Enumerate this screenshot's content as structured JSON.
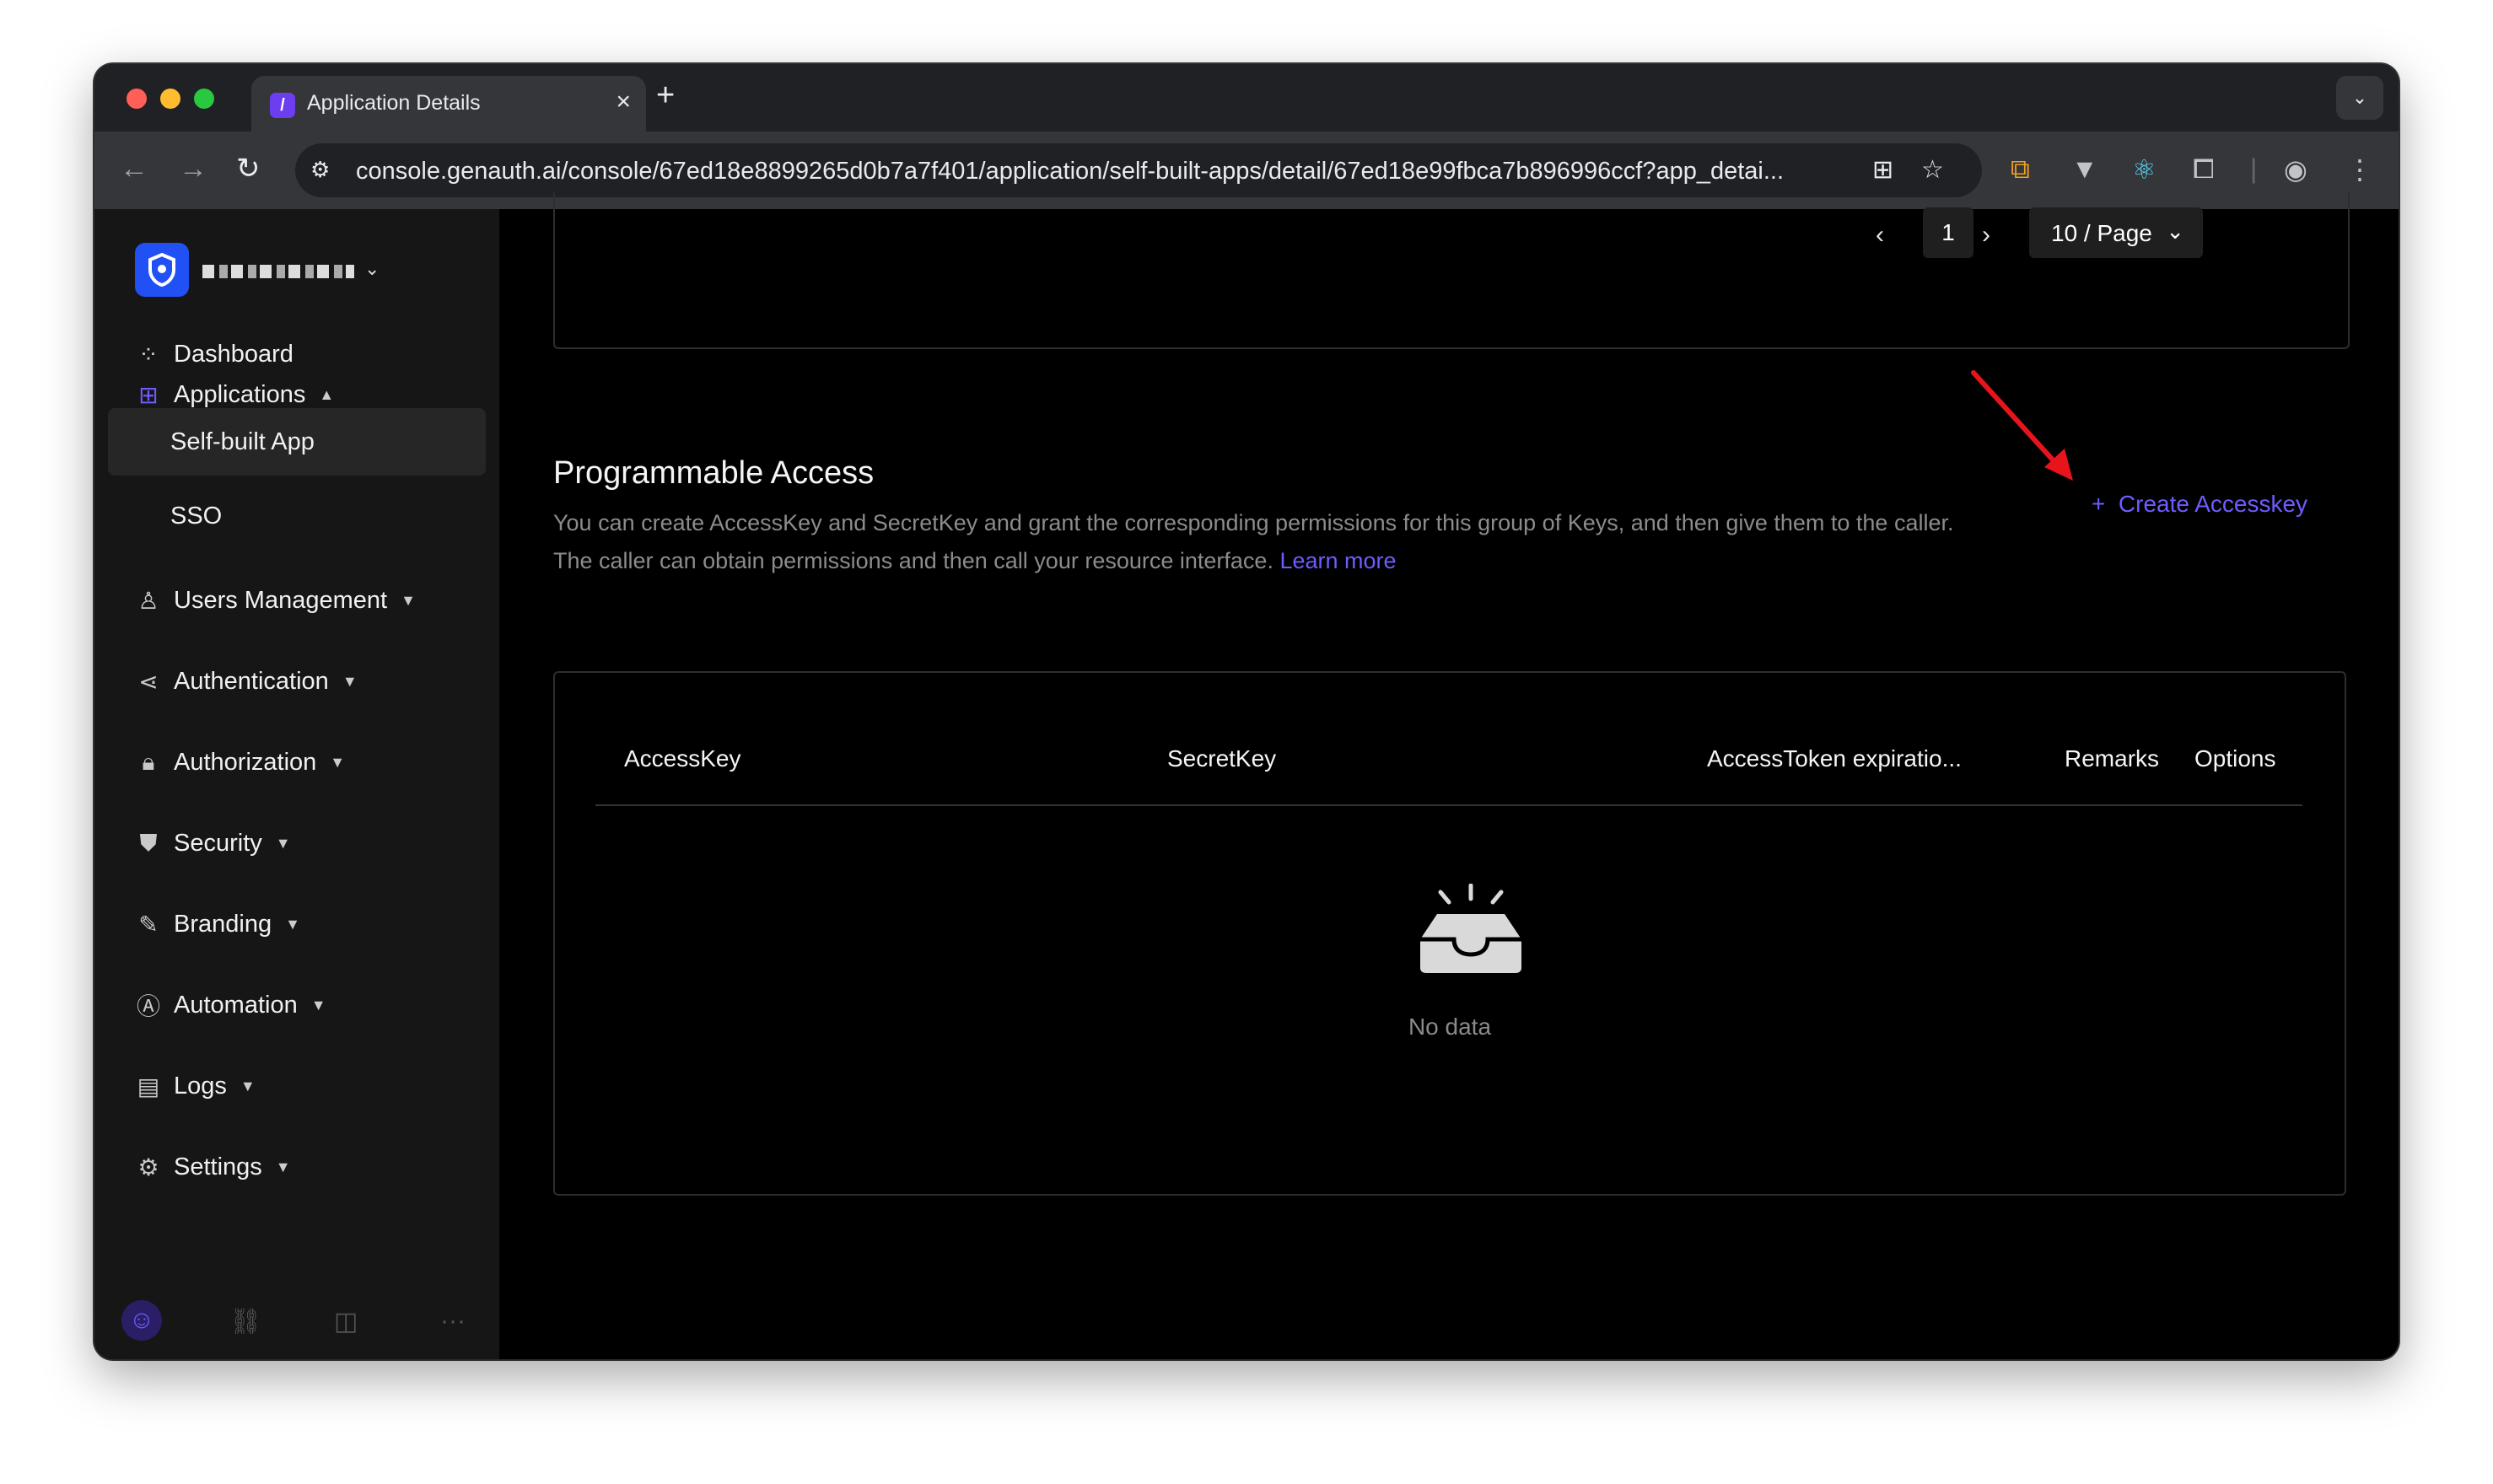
{
  "browser": {
    "tab_title": "Application Details",
    "tab_favicon": "genauth-logo",
    "url": "console.genauth.ai/console/67ed18e8899265d0b7a7f401/application/self-built-apps/detail/67ed18e99fbca7b896996ccf?app_detai..."
  },
  "sidebar": {
    "items": [
      {
        "label": "Dashboard",
        "icon": "dashboard-icon"
      },
      {
        "label": "Applications",
        "icon": "applications-icon"
      },
      {
        "label": "Users Management",
        "icon": "user-icon"
      },
      {
        "label": "Authentication",
        "icon": "share-icon"
      },
      {
        "label": "Authorization",
        "icon": "lock-icon"
      },
      {
        "label": "Security",
        "icon": "shield-icon"
      },
      {
        "label": "Branding",
        "icon": "brush-icon"
      },
      {
        "label": "Automation",
        "icon": "automation-icon"
      },
      {
        "label": "Logs",
        "icon": "logs-icon"
      },
      {
        "label": "Settings",
        "icon": "gear-icon"
      }
    ],
    "sub_items": [
      {
        "label": "Self-built App",
        "active": true
      },
      {
        "label": "SSO",
        "active": false
      }
    ]
  },
  "pagination": {
    "current_page": "1",
    "page_size": "10 / Page"
  },
  "programmable_access": {
    "title": "Programmable Access",
    "description_line1": "You can create AccessKey and SecretKey and grant the corresponding permissions for this group of Keys, and then give them to the caller.",
    "description_line2": "The caller can obtain permissions and then call your resource interface.",
    "learn_more": "Learn more",
    "create_button": "Create Accesskey"
  },
  "table": {
    "columns": [
      "AccessKey",
      "SecretKey",
      "AccessToken expiratio...",
      "Remarks",
      "Options"
    ],
    "empty_text": "No data"
  },
  "colors": {
    "accent": "#6d5cff",
    "annotation_arrow": "#e8141c",
    "brand_logo": "#2151f5"
  }
}
